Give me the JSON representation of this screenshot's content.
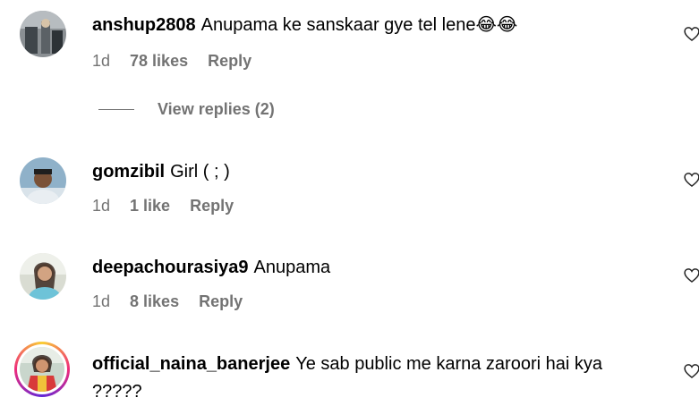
{
  "comments": [
    {
      "username": "anshup2808",
      "text": "Anupama ke sanskaar gye tel lene😂😂",
      "time": "1d",
      "likes": "78 likes",
      "reply": "Reply",
      "view_replies": "View replies (2)"
    },
    {
      "username": "gomzibil",
      "text": "Girl ( ; )",
      "time": "1d",
      "likes": "1 like",
      "reply": "Reply"
    },
    {
      "username": "deepachourasiya9",
      "text": "Anupama",
      "time": "1d",
      "likes": "8 likes",
      "reply": "Reply"
    },
    {
      "username": "official_naina_banerjee",
      "text": "Ye sab public me karna zaroori hai kya ?????"
    }
  ],
  "icons": {
    "like": "heart-outline-icon"
  },
  "colors": {
    "meta_text": "#737373",
    "story_ring": [
      "#f9ce34",
      "#ee2a7b",
      "#6228d7"
    ]
  }
}
